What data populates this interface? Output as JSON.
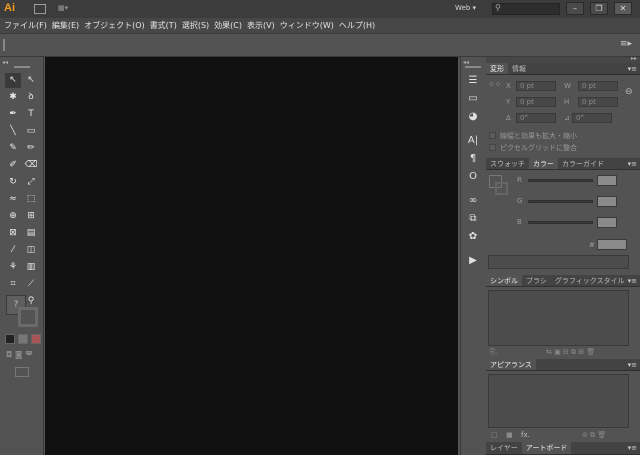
{
  "app": {
    "logo": "Ai",
    "workspace": "Web",
    "window_buttons": [
      "–",
      "❐",
      "✕"
    ]
  },
  "menu": [
    "ファイル(F)",
    "編集(E)",
    "オブジェクト(O)",
    "書式(T)",
    "選択(S)",
    "効果(C)",
    "表示(V)",
    "ウィンドウ(W)",
    "ヘルプ(H)"
  ],
  "tools": [
    {
      "name": "selection-tool",
      "glyph": "↖"
    },
    {
      "name": "direct-selection-tool",
      "glyph": "↖"
    },
    {
      "name": "magic-wand-tool",
      "glyph": "✱"
    },
    {
      "name": "lasso-tool",
      "glyph": "ꝺ"
    },
    {
      "name": "pen-tool",
      "glyph": "✒"
    },
    {
      "name": "type-tool",
      "glyph": "T"
    },
    {
      "name": "line-tool",
      "glyph": "╲"
    },
    {
      "name": "rectangle-tool",
      "glyph": "▭"
    },
    {
      "name": "paintbrush-tool",
      "glyph": "✎"
    },
    {
      "name": "pencil-tool",
      "glyph": "✏"
    },
    {
      "name": "blob-brush-tool",
      "glyph": "✐"
    },
    {
      "name": "eraser-tool",
      "glyph": "⌫"
    },
    {
      "name": "rotate-tool",
      "glyph": "↻"
    },
    {
      "name": "scale-tool",
      "glyph": "⤢"
    },
    {
      "name": "warp-tool",
      "glyph": "≈"
    },
    {
      "name": "free-transform-tool",
      "glyph": "⬚"
    },
    {
      "name": "shape-builder-tool",
      "glyph": "⊕"
    },
    {
      "name": "perspective-grid-tool",
      "glyph": "⊞"
    },
    {
      "name": "mesh-tool",
      "glyph": "⊠"
    },
    {
      "name": "gradient-tool",
      "glyph": "▤"
    },
    {
      "name": "eyedropper-tool",
      "glyph": "⁄"
    },
    {
      "name": "blend-tool",
      "glyph": "◫"
    },
    {
      "name": "symbol-sprayer-tool",
      "glyph": "⚘"
    },
    {
      "name": "column-graph-tool",
      "glyph": "▥"
    },
    {
      "name": "artboard-tool",
      "glyph": "⌗"
    },
    {
      "name": "slice-tool",
      "glyph": "⟋"
    },
    {
      "name": "hand-tool",
      "glyph": "✋"
    },
    {
      "name": "zoom-tool",
      "glyph": "⚲"
    }
  ],
  "dock_icons": [
    "menu-lines-icon",
    "gradient-swatch-icon",
    "transparency-icon",
    "character-icon",
    "paragraph-icon",
    "opentype-icon",
    "link-icon",
    "symbols-icon",
    "graphic-styles-icon",
    "play-action-icon"
  ],
  "dock_glyphs": [
    "☰",
    "▭",
    "◕",
    "A|",
    "¶",
    "O",
    "∞",
    "⧉",
    "✿",
    "▶"
  ],
  "transform_panel": {
    "tabs": [
      "変形",
      "情報"
    ],
    "x_label": "X",
    "y_label": "Y",
    "w_label": "W",
    "h_label": "H",
    "x": "0 pt",
    "y": "0 pt",
    "w": "0 pt",
    "h": "0 pt",
    "rotate": "0°",
    "shear": "0°",
    "option1": "線幅と効果も拡大・縮小",
    "option2": "ピクセルグリッドに整合"
  },
  "color_panel": {
    "tabs": [
      "スウォッチ",
      "カラー",
      "カラーガイド"
    ],
    "channels": [
      "R",
      "G",
      "B"
    ],
    "hex_prefix": "#"
  },
  "symbol_panel": {
    "tabs": [
      "シンボル",
      "ブラシ",
      "グラフィックスタイル"
    ]
  },
  "appearance_panel": {
    "tabs": [
      "アピアランス"
    ],
    "fx": "fx."
  },
  "bottom_tabs": [
    "レイヤー",
    "アートボード"
  ]
}
